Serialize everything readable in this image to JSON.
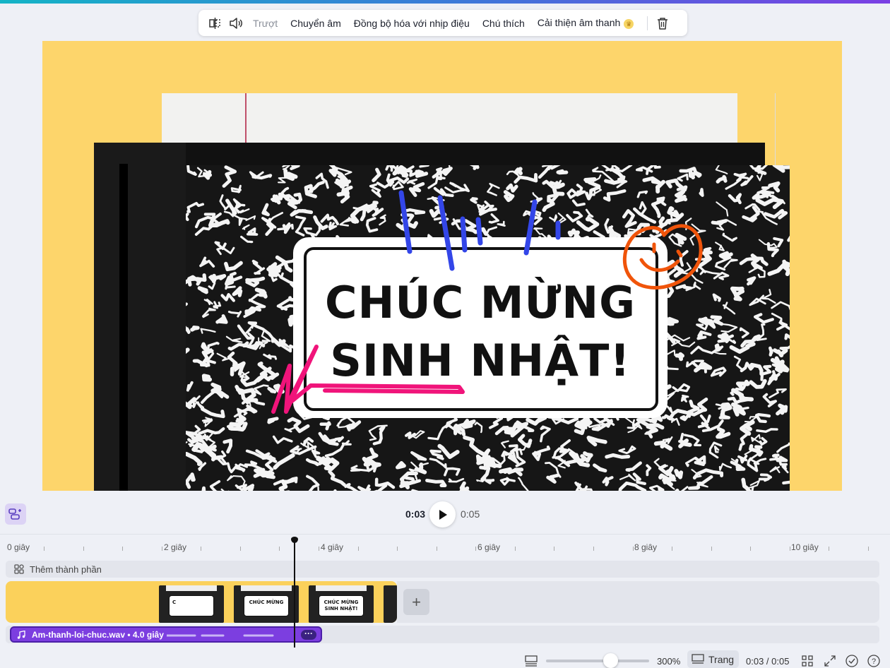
{
  "toolbar": {
    "items": [
      "Trượt",
      "Chuyển âm",
      "Đồng bộ hóa với nhịp điệu",
      "Chú thích",
      "Cải thiện âm thanh"
    ]
  },
  "canvas": {
    "title_line1": "CHÚC MỪNG",
    "title_line2": "SINH NHẬT!"
  },
  "playback": {
    "current": "0:03",
    "total": "0:05"
  },
  "ruler": {
    "labels": [
      "0 giây",
      "2 giây",
      "4 giây",
      "6 giây",
      "8 giây",
      "10 giây"
    ]
  },
  "timeline": {
    "add_element_label": "Thêm thành phần",
    "thumbs": [
      {
        "text": "C"
      },
      {
        "text": "CHÚC MỪNG"
      },
      {
        "text": "CHÚC MỪNG SINH NHẬT!"
      }
    ],
    "audio_label": "Am-thanh-loi-chuc.wav • 4.0 giây"
  },
  "bottom_bar": {
    "zoom": "300%",
    "zoom_level_fraction": 0.62,
    "page_label": "Trang",
    "time_readout": "0:03 / 0:05"
  },
  "colors": {
    "canvas_bg": "#fdd56b",
    "accent": "#7c3ee0",
    "scribble_blue": "#3346e8",
    "scribble_pink": "#f0147a",
    "scribble_orange": "#f0540a"
  }
}
